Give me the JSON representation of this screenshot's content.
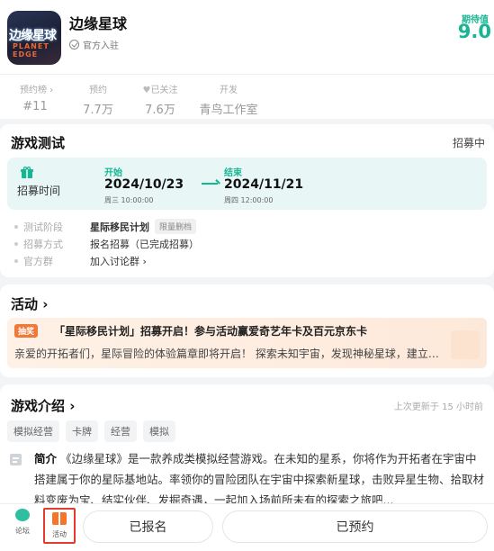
{
  "header": {
    "game_title": "边缘星球",
    "logo_text_top": "边缘星球",
    "logo_text_bottom": "PLANET EDGE",
    "official_label": "官方入驻",
    "score_label": "期待值",
    "score_value": "9.0"
  },
  "stats": [
    {
      "label": "预约榜 ›",
      "value": "#11"
    },
    {
      "label": "预约",
      "value": "7.7万"
    },
    {
      "label": "已关注",
      "value": "7.6万"
    },
    {
      "label": "开发",
      "value": "青鸟工作室"
    }
  ],
  "test": {
    "title": "游戏测试",
    "status": "招募中",
    "recruit_label": "招募时间",
    "start_label": "开始",
    "start_date": "2024/10/23",
    "start_sub": "周三 10:00:00",
    "end_label": "结束",
    "end_date": "2024/11/21",
    "end_sub": "周四 12:00:00",
    "rows": [
      {
        "key": "测试阶段",
        "value": "星际移民计划",
        "tag": "限量删档"
      },
      {
        "key": "招募方式",
        "value": "报名招募（已完成招募）"
      },
      {
        "key": "官方群",
        "value": "加入讨论群 ›"
      }
    ]
  },
  "activity": {
    "title": "活动 ›",
    "badge": "抽奖",
    "banner_title": "「星际移民计划」招募开启！参与活动赢爱奇艺年卡及百元京东卡",
    "banner_desc": "亲爱的开拓者们，星际冒险的体验篇章即将开启！ 探索未知宇宙，发现神秘星球，建立…"
  },
  "intro": {
    "title": "游戏介绍 ›",
    "updated": "上次更新于 15 小时前",
    "tags": [
      "模拟经营",
      "卡牌",
      "经营",
      "模拟"
    ],
    "desc_label": "简介",
    "desc_text": "《边缘星球》是一款养成类模拟经营游戏。在未知的星系，你将作为开拓者在宇宙中搭建属于你的星际基地站。率领你的冒险团队在宇宙中探索新星球，击败异星生物、拾取材料变废为宝、结实伙伴、发掘奇遇，一起加入场前所未有的探索之旅吧..."
  },
  "bottombar": {
    "forum_label": "论坛",
    "activity_label": "活动",
    "registered_label": "已报名",
    "reserved_label": "已预约"
  },
  "colors": {
    "accent": "#17b594",
    "activity_highlight": "#e53b2f"
  }
}
